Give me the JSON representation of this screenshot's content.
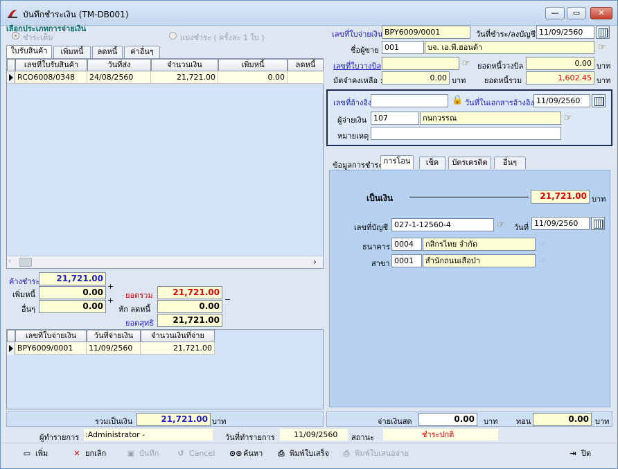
{
  "window": {
    "title": "บันทึกชำระเงิน (TM-DB001)",
    "btn_min": "—",
    "btn_max": "▭",
    "btn_close": "✕"
  },
  "payment_type": {
    "group_label": "เลือกประเภทการจ่ายเงิน",
    "full_label": "ชำระเต็ม",
    "partial_label": "แบ่งชำระ ( ครั้งละ 1 ใบ )"
  },
  "left_tabs": [
    "ใบรับสินค้า",
    "เพิ่มหนี้",
    "ลดหนี้",
    "ค่าอื่นๆ"
  ],
  "receipts_grid": {
    "columns": [
      "เลขที่ใบรับสินค้า",
      "วันที่ส่ง",
      "จำนวนเงิน",
      "เพิ่มหนี้",
      "ลดหนี้"
    ],
    "rows": [
      [
        "RCO6008/0348",
        "24/08/2560",
        "21,721.00",
        "0.00",
        ""
      ]
    ]
  },
  "summary": {
    "owed_label": "ค้างชำระ",
    "owed": "21,721.00",
    "add_debt_label": "เพิ่มหนี้",
    "add_debt": "0.00",
    "other_label": "อื่นๆ",
    "other": "0.00",
    "total_label": "ยอดรวม",
    "total": "21,721.00",
    "reduce_label": "หัก ลดหนี้",
    "reduce": "0.00",
    "net_label": "ยอดสุทธิ",
    "net": "21,721.00",
    "plus": "+",
    "minus": "−"
  },
  "payments_grid": {
    "columns": [
      "เลขที่ใบจ่ายเงิน",
      "วันที่จ่ายเงิน",
      "จำนวนเงินที่จ่าย"
    ],
    "rows": [
      [
        "BPY6009/0001",
        "11/09/2560",
        "21,721.00"
      ]
    ]
  },
  "footer_left": {
    "label": "รวมเป็นเงิน",
    "value": "21,721.00",
    "unit": "บาท"
  },
  "header": {
    "doc_no_label": "เลขที่ใบจ่ายเงิน",
    "doc_no": "BPY6009/0001",
    "pay_date_label": "วันที่ชำระ/ลงบัญชี",
    "pay_date": "11/09/2560",
    "vendor_label": "ชื่อผู้ขาย :",
    "vendor_code": "001",
    "vendor_name": "บจ. เอ.พี.ฮอนด้า",
    "bill_label": "เลขที่ใบวางบิล",
    "bill_no": "",
    "bill_debt_label": "ยอดหนี้วางบิล",
    "bill_debt": "0.00",
    "deposit_label": "มัดจำคงเหลือ :",
    "deposit": "0.00",
    "total_debt_label": "ยอดหนี้รวม",
    "total_debt": "1,602.45",
    "unit": "บาท"
  },
  "ref": {
    "ref_label": "เลขที่อ้างอิง",
    "ref_no": "",
    "ref_date_label": "วันที่ในเอกสารอ้างอิง",
    "ref_date": "11/09/2560",
    "payer_label": "ผู้จ่ายเงิน",
    "payer_code": "107",
    "payer_name": "กนกวรรณ",
    "note_label": "หมายเหตุ",
    "note": ""
  },
  "right_tabs": {
    "caption": "ข้อมูลการชำระ",
    "items": [
      "การโอน",
      "เช็ค",
      "บัตรเครดิต",
      "อื่นๆ"
    ]
  },
  "transfer": {
    "amount_label": "เป็นเงิน",
    "amount": "21,721.00",
    "unit": "บาท",
    "account_label": "เลขที่บัญชี",
    "account": "027-1-12560-4",
    "date_label": "วันที่",
    "date": "11/09/2560",
    "bank_label": "ธนาคาร",
    "bank_code": "0004",
    "bank_name": "กสิกรไทย จำกัด",
    "branch_label": "สาขา",
    "branch_code": "0001",
    "branch_name": "สำนักถนนเสือป่า"
  },
  "footer_right": {
    "cash_label": "จ่ายเงินสด",
    "cash": "0.00",
    "unit": "บาท",
    "change_label": "ทอน",
    "change": "0.00"
  },
  "status": {
    "user_label": "ผู้ทำรายการ",
    "user": ":Administrator -",
    "date_label": "วันที่ทำรายการ",
    "date": "11/09/2560",
    "state_label": "สถานะ",
    "state": "ชำระปกติ"
  },
  "toolbar": {
    "add": "เพิ่ม",
    "cancel_doc": "ยกเลิก",
    "save": "บันทึก",
    "cancel": "Cancel",
    "search": "ค้นหา",
    "print_receipt": "พิมพ์ใบเสร็จ",
    "print_proposal": "พิมพ์ใบเสนอจ่าย",
    "close": "ปิด"
  }
}
